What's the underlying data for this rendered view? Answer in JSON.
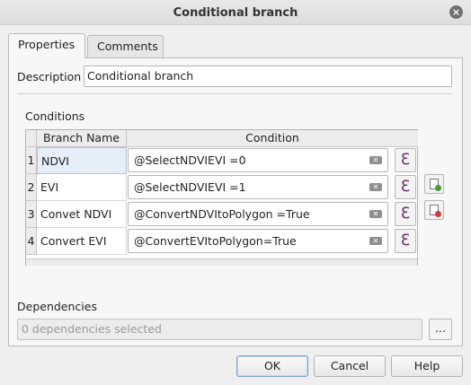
{
  "window": {
    "title": "Conditional branch",
    "close_icon": "×"
  },
  "tabs": [
    {
      "label": "Properties",
      "active": true
    },
    {
      "label": "Comments",
      "active": false
    }
  ],
  "description": {
    "label": "Description",
    "value": "Conditional branch"
  },
  "conditions": {
    "label": "Conditions",
    "columns": [
      "Branch Name",
      "Condition"
    ],
    "rows": [
      {
        "num": "1",
        "name": "NDVI",
        "condition": "@SelectNDVIEVI =0"
      },
      {
        "num": "2",
        "name": "EVI",
        "condition": "@SelectNDVIEVI =1"
      },
      {
        "num": "3",
        "name": "Convet NDVI",
        "condition": "@ConvertNDVItoPolygon =True"
      },
      {
        "num": "4",
        "name": "Convert EVI",
        "condition": "@ConvertEVItoPolygon=True"
      }
    ],
    "expression_icon": "ℇ",
    "clear_icon": "✕"
  },
  "dependencies": {
    "label": "Dependencies",
    "placeholder": "0 dependencies selected",
    "browse_label": "..."
  },
  "buttons": {
    "ok": "OK",
    "cancel": "Cancel",
    "help": "Help"
  },
  "colors": {
    "add": "#4a9a3a",
    "remove": "#d23b3b",
    "expression": "#6b2f6b"
  }
}
